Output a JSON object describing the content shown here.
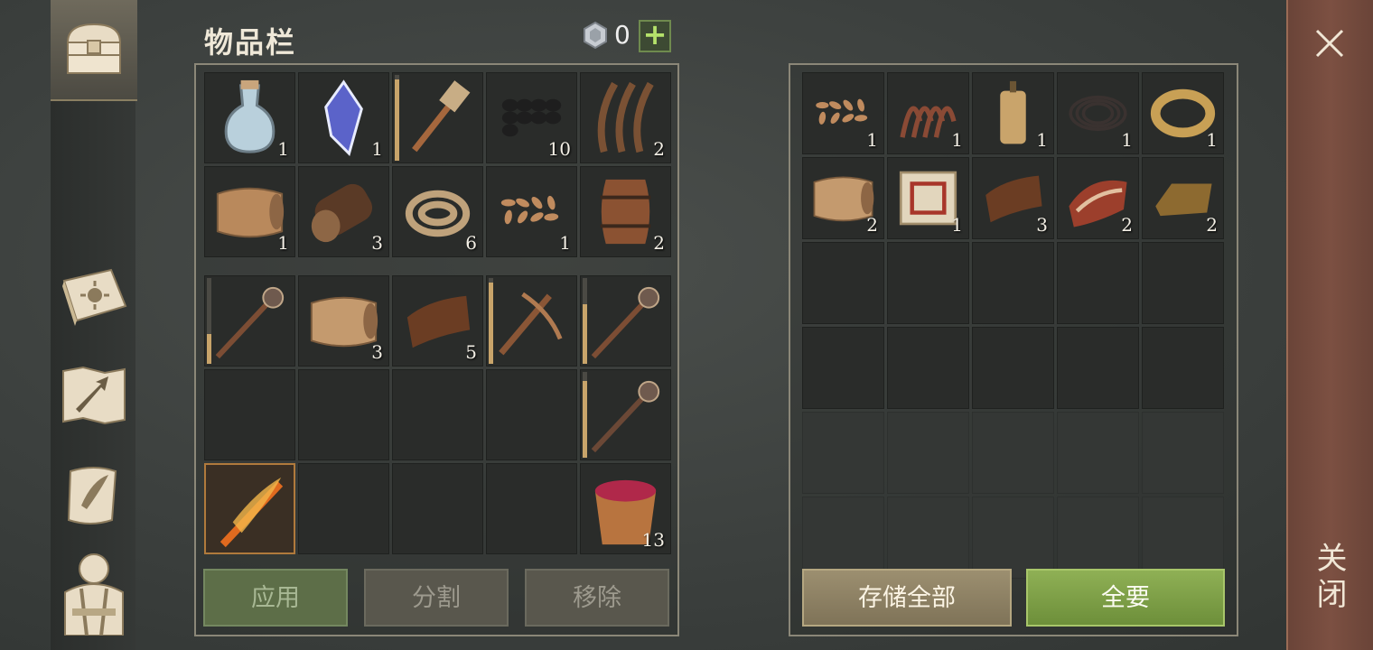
{
  "inventory": {
    "title": "物品栏",
    "currency_icon": "gem-coin-icon",
    "currency_amount": "0",
    "add_label": "+"
  },
  "bag_items": [
    {
      "icon": "potion-flask-icon",
      "count": "1",
      "color": "#b9d0dc"
    },
    {
      "icon": "crystal-shard-icon",
      "count": "1",
      "color": "#5b63c9"
    },
    {
      "icon": "hammer-icon",
      "count": "",
      "color": "#c8ad85",
      "durability": 0.95
    },
    {
      "icon": "coal-pile-icon",
      "count": "10",
      "color": "#1e1e1e"
    },
    {
      "icon": "plant-fiber-icon",
      "count": "2",
      "color": "#7a5134"
    },
    {
      "icon": "cloth-roll-icon",
      "count": "1",
      "color": "#b9895c"
    },
    {
      "icon": "log-icon",
      "count": "3",
      "color": "#5a3a26"
    },
    {
      "icon": "rope-coil-icon",
      "count": "6",
      "color": "#bfa27b"
    },
    {
      "icon": "seeds-icon",
      "count": "1",
      "color": "#c08b5e"
    },
    {
      "icon": "barrel-icon",
      "count": "2",
      "color": "#8b5232"
    }
  ],
  "equip_rows": [
    {
      "icon": "mace-icon",
      "count": "",
      "color": "#7c4d34",
      "durability": 0.35
    },
    {
      "icon": "folded-cloth-icon",
      "count": "3",
      "color": "#c49a6e"
    },
    {
      "icon": "leather-icon",
      "count": "5",
      "color": "#6b3d23"
    },
    {
      "icon": "crossbow-icon",
      "count": "",
      "color": "#8a5636",
      "durability": 0.95
    },
    {
      "icon": "mace-icon",
      "count": "",
      "color": "#7c4d34",
      "durability": 0.7
    },
    {
      "icon": "",
      "count": ""
    },
    {
      "icon": "",
      "count": ""
    },
    {
      "icon": "",
      "count": ""
    },
    {
      "icon": "",
      "count": ""
    },
    {
      "icon": "spear-mace-icon",
      "count": "",
      "color": "#6b4836",
      "durability": 0.9
    },
    {
      "icon": "flaming-sword-icon",
      "count": "",
      "color": "#e06a1f",
      "selected": true
    },
    {
      "icon": "",
      "count": ""
    },
    {
      "icon": "",
      "count": ""
    },
    {
      "icon": "",
      "count": ""
    },
    {
      "icon": "berry-bucket-icon",
      "count": "13",
      "color": "#b8743f"
    }
  ],
  "storage_items": [
    {
      "icon": "seeds-icon",
      "count": "1",
      "color": "#c08b5e"
    },
    {
      "icon": "worms-icon",
      "count": "1",
      "color": "#8a4a35"
    },
    {
      "icon": "candle-icon",
      "count": "1",
      "color": "#c9a46b"
    },
    {
      "icon": "wire-coil-icon",
      "count": "1",
      "color": "#3a3230"
    },
    {
      "icon": "gold-ring-icon",
      "count": "1",
      "color": "#c8a055"
    },
    {
      "icon": "folded-cloth-icon",
      "count": "2",
      "color": "#c49a6e"
    },
    {
      "icon": "recipe-scroll-icon",
      "count": "1",
      "color": "#e2d6bd"
    },
    {
      "icon": "leather-icon",
      "count": "3",
      "color": "#6b3d23"
    },
    {
      "icon": "raw-meat-icon",
      "count": "2",
      "color": "#9c3f2c"
    },
    {
      "icon": "gold-ingot-icon",
      "count": "2",
      "color": "#8d6a30"
    }
  ],
  "buttons": {
    "apply": "应用",
    "split": "分割",
    "remove": "移除",
    "store_all": "存储全部",
    "take_all": "全要"
  },
  "close": {
    "label": "关闭",
    "icon": "close-icon"
  },
  "sidebar": [
    {
      "icon": "chest-icon",
      "active": true
    },
    {
      "icon": "sun-book-icon"
    },
    {
      "icon": "map-arrow-icon"
    },
    {
      "icon": "quest-scroll-icon"
    },
    {
      "icon": "character-vest-icon"
    }
  ]
}
